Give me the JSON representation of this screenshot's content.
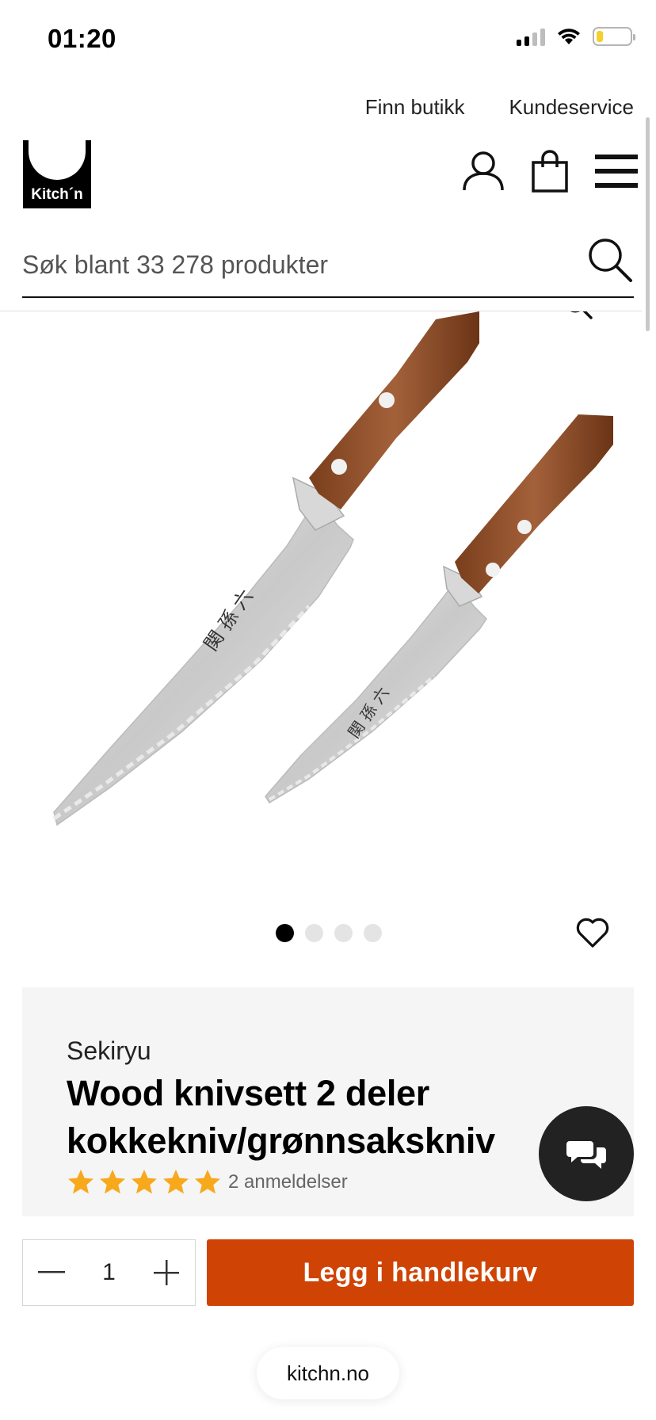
{
  "status_bar": {
    "time": "01:20",
    "icons": [
      "signal-icon",
      "wifi-icon",
      "battery-icon"
    ]
  },
  "top_links": {
    "find_store": "Finn butikk",
    "customer_service": "Kundeservice"
  },
  "header": {
    "logo_text": "Kitch´n",
    "icons": [
      "user-icon",
      "shopping-bag-icon",
      "menu-icon"
    ]
  },
  "search": {
    "placeholder": "Søk blant 33 278 produkter"
  },
  "product": {
    "image_description_icon": "knife-set-image",
    "carousel": {
      "total": 4,
      "active": 1
    },
    "brand": "Sekiryu",
    "title": "Wood knivsett 2 deler kokkekniv/grønnsakskniv",
    "rating": 5,
    "reviews": "2 anmeldelser"
  },
  "purchase": {
    "quantity": "1",
    "add_to_cart": "Legg i handlekurv"
  },
  "browser": {
    "url": "kitchn.no"
  },
  "colors": {
    "accent": "#cf4305",
    "star": "#f7a81b",
    "info_bg": "#f5f5f5",
    "chat_bg": "#222222"
  }
}
